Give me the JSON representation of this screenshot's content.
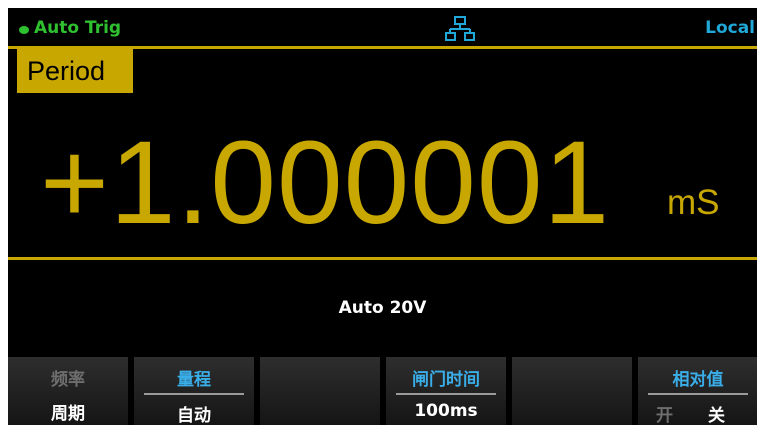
{
  "status": {
    "trigger_mode": "Auto Trig",
    "remote_state": "Local",
    "lan_icon": "network-icon"
  },
  "function_label": "Period",
  "measurement": {
    "value": "+1.000001",
    "unit": "mS"
  },
  "range_info": "Auto 20V",
  "softkeys": [
    {
      "title": "频率",
      "value": "周期"
    },
    {
      "title": "量程",
      "value": "自动"
    },
    {
      "title": "",
      "value": ""
    },
    {
      "title": "闸门时间",
      "value": "100ms"
    },
    {
      "title": "",
      "value": ""
    },
    {
      "title": "相对值",
      "options": [
        "开",
        "关"
      ],
      "selected": "关"
    }
  ],
  "colors": {
    "accent_gold": "#c8a800",
    "status_green": "#2fc02f",
    "status_blue": "#1fa8d8",
    "softkey_title_blue": "#3aaee8"
  }
}
